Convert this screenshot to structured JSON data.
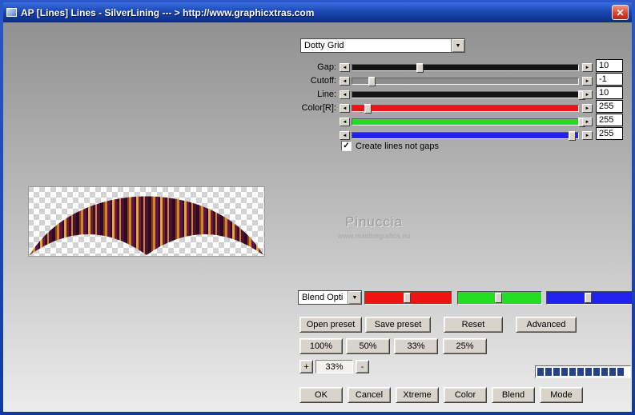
{
  "window": {
    "title": "AP [Lines]  Lines - SilverLining    --- > http://www.graphicxtras.com"
  },
  "icons": {
    "close": "✕",
    "left_arrow": "◄",
    "right_arrow": "►",
    "dropdown": "▼",
    "check": "✓"
  },
  "panel": {
    "preset_dropdown": {
      "value": "Dotty Grid"
    },
    "sliders": [
      {
        "label": "Gap:",
        "value": "10",
        "color": "#141414",
        "pos": 25
      },
      {
        "label": "Cutoff:",
        "value": "-1",
        "color": "#8d8d8d",
        "pos": 4
      },
      {
        "label": "Line:",
        "value": "10",
        "color": "#141414",
        "pos": 96
      },
      {
        "label": "Color[R]:",
        "value": "255",
        "color": "#ee1414",
        "pos": 2
      },
      {
        "label": "",
        "value": "255",
        "color": "#22dd22",
        "pos": 96
      },
      {
        "label": "",
        "value": "255",
        "color": "#2222ee",
        "pos": 92
      }
    ],
    "checkbox": {
      "label": "Create lines not gaps",
      "checked": true
    },
    "watermark": {
      "line1": "Pinuccia",
      "line2": "www.maidiregrafica.eu"
    },
    "blend": {
      "dropdown": "Blend Opti",
      "sliders": [
        {
          "color": "#ee1414",
          "pos": 48
        },
        {
          "color": "#22dd22",
          "pos": 48
        },
        {
          "color": "#2222ee",
          "pos": 48
        }
      ]
    },
    "preset_buttons": [
      "Open preset",
      "Save preset",
      "Reset",
      "Advanced"
    ],
    "zoom_buttons": [
      "100%",
      "50%",
      "33%",
      "25%"
    ],
    "zoom_spinner": {
      "plus": "+",
      "value": "33%",
      "minus": "-"
    },
    "progress": {
      "segments": 11,
      "filled": 11,
      "color": "#26418c"
    },
    "bottom_buttons": [
      "OK",
      "Cancel",
      "Xtreme",
      "Color",
      "Blend",
      "Mode"
    ]
  }
}
